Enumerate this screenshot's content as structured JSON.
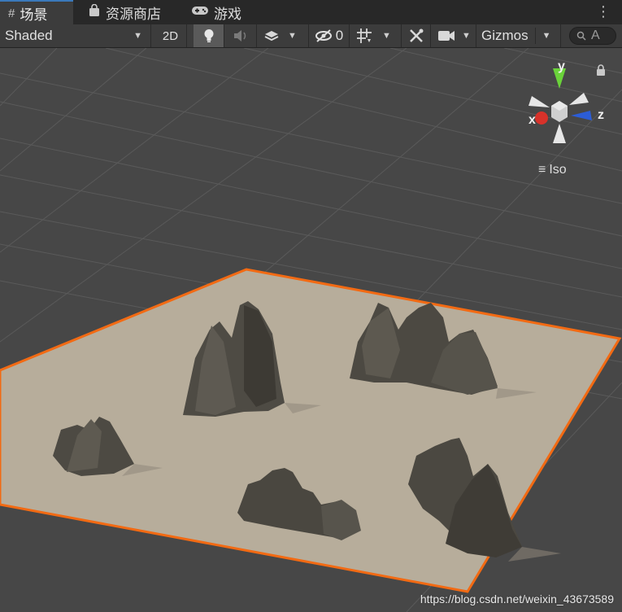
{
  "tabs": [
    {
      "icon": "scene-grid-icon",
      "glyph": "#",
      "label": "场景",
      "active": true
    },
    {
      "icon": "asset-store-bag-icon",
      "glyph": "🛍",
      "label": "资源商店",
      "active": false
    },
    {
      "icon": "gamepad-icon",
      "glyph": "🎮",
      "label": "游戏",
      "active": false
    }
  ],
  "toolbar": {
    "draw_mode": "Shaded",
    "mode_2d": "2D",
    "hidden_count": "0",
    "gizmos": "Gizmos",
    "search_placeholder": "A"
  },
  "gizmo": {
    "y": "y",
    "x": "x",
    "z": "z",
    "projection": "Iso"
  },
  "watermark": "https://blog.csdn.net/weixin_43673589",
  "colors": {
    "accent": "#3a79bb",
    "selection_outline": "#f26a13",
    "terrain": "#b7ad9b"
  }
}
